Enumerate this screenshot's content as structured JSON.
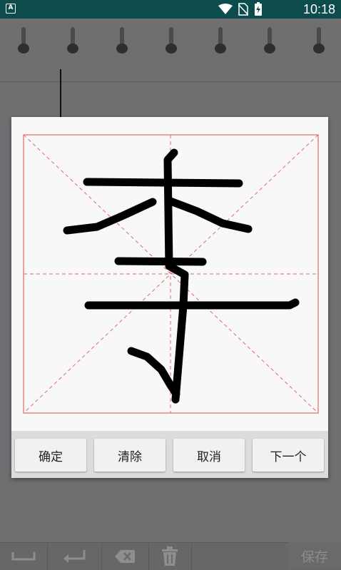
{
  "status_bar": {
    "time": "10:18"
  },
  "dialog": {
    "buttons": {
      "confirm": "确定",
      "clear": "清除",
      "cancel": "取消",
      "next": "下一个"
    }
  },
  "bottom_bar": {
    "save_label": "保存"
  },
  "icons": {
    "status": [
      "app-notification-icon",
      "wifi-icon",
      "no-sim-icon",
      "battery-charging-icon"
    ],
    "toolbar": [
      "space-icon",
      "enter-icon",
      "backspace-icon",
      "trash-icon"
    ]
  },
  "colors": {
    "status_bar": "#0c4c4c",
    "grid_line": "#e06a6a",
    "ink": "#000000",
    "dialog_bg": "#f8f8f8"
  }
}
